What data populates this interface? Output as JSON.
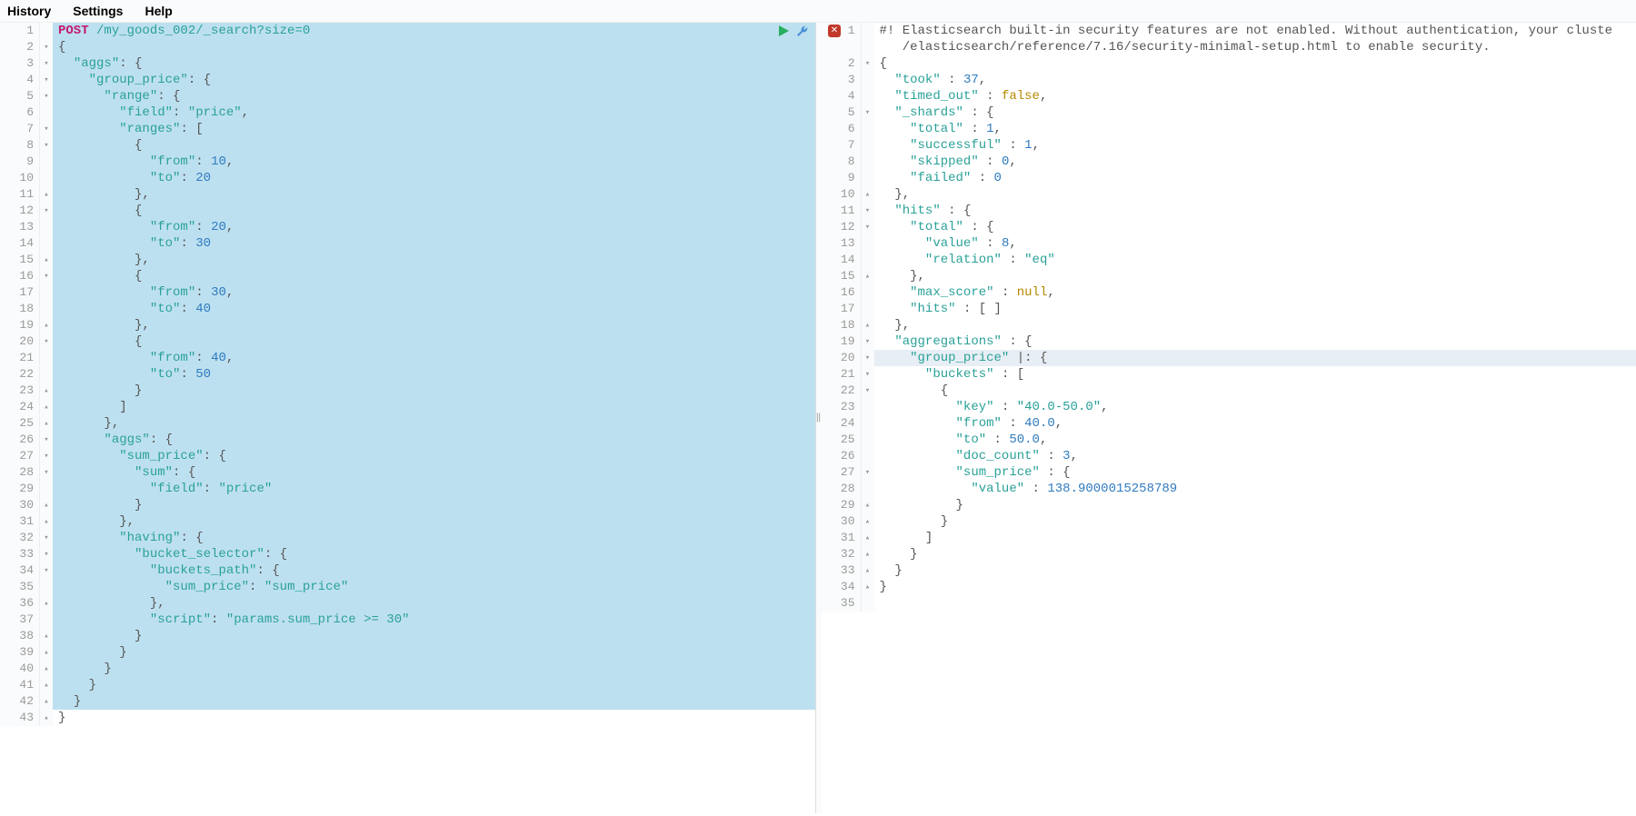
{
  "menu": {
    "history": "History",
    "settings": "Settings",
    "help": "Help"
  },
  "request": {
    "method": "POST",
    "url": "/my_goods_002/_search?size=0",
    "lines": [
      {
        "n": 1,
        "f": "",
        "html": "<span class='method'>POST</span> <span class='url'>/my_goods_002/_search?size=0</span>"
      },
      {
        "n": 2,
        "f": "▾",
        "html": "<span class='pun'>{</span>"
      },
      {
        "n": 3,
        "f": "▾",
        "html": "  <span class='str'>\"aggs\"</span><span class='pun'>: {</span>"
      },
      {
        "n": 4,
        "f": "▾",
        "html": "    <span class='str'>\"group_price\"</span><span class='pun'>: {</span>"
      },
      {
        "n": 5,
        "f": "▾",
        "html": "      <span class='str'>\"range\"</span><span class='pun'>: {</span>"
      },
      {
        "n": 6,
        "f": "",
        "html": "        <span class='str'>\"field\"</span><span class='pun'>: </span><span class='str'>\"price\"</span><span class='pun'>,</span>"
      },
      {
        "n": 7,
        "f": "▾",
        "html": "        <span class='str'>\"ranges\"</span><span class='pun'>: [</span>"
      },
      {
        "n": 8,
        "f": "▾",
        "html": "          <span class='pun'>{</span>"
      },
      {
        "n": 9,
        "f": "",
        "html": "            <span class='str'>\"from\"</span><span class='pun'>: </span><span class='num'>10</span><span class='pun'>,</span>"
      },
      {
        "n": 10,
        "f": "",
        "html": "            <span class='str'>\"to\"</span><span class='pun'>: </span><span class='num'>20</span>"
      },
      {
        "n": 11,
        "f": "▴",
        "html": "          <span class='pun'>},</span>"
      },
      {
        "n": 12,
        "f": "▾",
        "html": "          <span class='pun'>{</span>"
      },
      {
        "n": 13,
        "f": "",
        "html": "            <span class='str'>\"from\"</span><span class='pun'>: </span><span class='num'>20</span><span class='pun'>,</span>"
      },
      {
        "n": 14,
        "f": "",
        "html": "            <span class='str'>\"to\"</span><span class='pun'>: </span><span class='num'>30</span>"
      },
      {
        "n": 15,
        "f": "▴",
        "html": "          <span class='pun'>},</span>"
      },
      {
        "n": 16,
        "f": "▾",
        "html": "          <span class='pun'>{</span>"
      },
      {
        "n": 17,
        "f": "",
        "html": "            <span class='str'>\"from\"</span><span class='pun'>: </span><span class='num'>30</span><span class='pun'>,</span>"
      },
      {
        "n": 18,
        "f": "",
        "html": "            <span class='str'>\"to\"</span><span class='pun'>: </span><span class='num'>40</span>"
      },
      {
        "n": 19,
        "f": "▴",
        "html": "          <span class='pun'>},</span>"
      },
      {
        "n": 20,
        "f": "▾",
        "html": "          <span class='pun'>{</span>"
      },
      {
        "n": 21,
        "f": "",
        "html": "            <span class='str'>\"from\"</span><span class='pun'>: </span><span class='num'>40</span><span class='pun'>,</span>"
      },
      {
        "n": 22,
        "f": "",
        "html": "            <span class='str'>\"to\"</span><span class='pun'>: </span><span class='num'>50</span>"
      },
      {
        "n": 23,
        "f": "▴",
        "html": "          <span class='pun'>}</span>"
      },
      {
        "n": 24,
        "f": "▴",
        "html": "        <span class='pun'>]</span>"
      },
      {
        "n": 25,
        "f": "▴",
        "html": "      <span class='pun'>},</span>"
      },
      {
        "n": 26,
        "f": "▾",
        "html": "      <span class='str'>\"aggs\"</span><span class='pun'>: {</span>"
      },
      {
        "n": 27,
        "f": "▾",
        "html": "        <span class='str'>\"sum_price\"</span><span class='pun'>: {</span>"
      },
      {
        "n": 28,
        "f": "▾",
        "html": "          <span class='str'>\"sum\"</span><span class='pun'>: {</span>"
      },
      {
        "n": 29,
        "f": "",
        "html": "            <span class='str'>\"field\"</span><span class='pun'>: </span><span class='str'>\"price\"</span>"
      },
      {
        "n": 30,
        "f": "▴",
        "html": "          <span class='pun'>}</span>"
      },
      {
        "n": 31,
        "f": "▴",
        "html": "        <span class='pun'>},</span>"
      },
      {
        "n": 32,
        "f": "▾",
        "html": "        <span class='str'>\"having\"</span><span class='pun'>: {</span>"
      },
      {
        "n": 33,
        "f": "▾",
        "html": "          <span class='str'>\"bucket_selector\"</span><span class='pun'>: {</span>"
      },
      {
        "n": 34,
        "f": "▾",
        "html": "            <span class='str'>\"buckets_path\"</span><span class='pun'>: {</span>"
      },
      {
        "n": 35,
        "f": "",
        "html": "              <span class='str'>\"sum_price\"</span><span class='pun'>: </span><span class='str'>\"sum_price\"</span>"
      },
      {
        "n": 36,
        "f": "▴",
        "html": "            <span class='pun'>},</span>"
      },
      {
        "n": 37,
        "f": "",
        "html": "            <span class='str'>\"script\"</span><span class='pun'>: </span><span class='str'>\"params.sum_price &gt;= 30\"</span>"
      },
      {
        "n": 38,
        "f": "▴",
        "html": "          <span class='pun'>}</span>"
      },
      {
        "n": 39,
        "f": "▴",
        "html": "        <span class='pun'>}</span>"
      },
      {
        "n": 40,
        "f": "▴",
        "html": "      <span class='pun'>}</span>"
      },
      {
        "n": 41,
        "f": "▴",
        "html": "    <span class='pun'>}</span>"
      },
      {
        "n": 42,
        "f": "▴",
        "html": "  <span class='pun'>}</span>"
      },
      {
        "n": 43,
        "f": "▴",
        "html": "<span class='pun'>}</span>",
        "noh": true
      }
    ]
  },
  "response": {
    "highlight_line": 20,
    "lines": [
      {
        "n": 1,
        "f": "",
        "err": true,
        "html": "<span class='kw'>#! Elasticsearch built-in security features are not enabled. Without authentication, your cluste</span>"
      },
      {
        "n": "",
        "f": "",
        "html": "   <span class='kw'>/elasticsearch/reference/7.16/security-minimal-setup.html to enable security.</span>"
      },
      {
        "n": 2,
        "f": "▾",
        "html": "<span class='pun'>{</span>"
      },
      {
        "n": 3,
        "f": "",
        "html": "  <span class='str'>\"took\"</span> <span class='pun'>:</span> <span class='num'>37</span><span class='pun'>,</span>"
      },
      {
        "n": 4,
        "f": "",
        "html": "  <span class='str'>\"timed_out\"</span> <span class='pun'>:</span> <span class='bool'>false</span><span class='pun'>,</span>"
      },
      {
        "n": 5,
        "f": "▾",
        "html": "  <span class='str'>\"_shards\"</span> <span class='pun'>: {</span>"
      },
      {
        "n": 6,
        "f": "",
        "html": "    <span class='str'>\"total\"</span> <span class='pun'>:</span> <span class='num'>1</span><span class='pun'>,</span>"
      },
      {
        "n": 7,
        "f": "",
        "html": "    <span class='str'>\"successful\"</span> <span class='pun'>:</span> <span class='num'>1</span><span class='pun'>,</span>"
      },
      {
        "n": 8,
        "f": "",
        "html": "    <span class='str'>\"skipped\"</span> <span class='pun'>:</span> <span class='num'>0</span><span class='pun'>,</span>"
      },
      {
        "n": 9,
        "f": "",
        "html": "    <span class='str'>\"failed\"</span> <span class='pun'>:</span> <span class='num'>0</span>"
      },
      {
        "n": 10,
        "f": "▴",
        "html": "  <span class='pun'>},</span>"
      },
      {
        "n": 11,
        "f": "▾",
        "html": "  <span class='str'>\"hits\"</span> <span class='pun'>: {</span>"
      },
      {
        "n": 12,
        "f": "▾",
        "html": "    <span class='str'>\"total\"</span> <span class='pun'>: {</span>"
      },
      {
        "n": 13,
        "f": "",
        "html": "      <span class='str'>\"value\"</span> <span class='pun'>:</span> <span class='num'>8</span><span class='pun'>,</span>"
      },
      {
        "n": 14,
        "f": "",
        "html": "      <span class='str'>\"relation\"</span> <span class='pun'>:</span> <span class='str'>\"eq\"</span>"
      },
      {
        "n": 15,
        "f": "▴",
        "html": "    <span class='pun'>},</span>"
      },
      {
        "n": 16,
        "f": "",
        "html": "    <span class='str'>\"max_score\"</span> <span class='pun'>:</span> <span class='null'>null</span><span class='pun'>,</span>"
      },
      {
        "n": 17,
        "f": "",
        "html": "    <span class='str'>\"hits\"</span> <span class='pun'>:</span> <span class='pun'>[ ]</span>"
      },
      {
        "n": 18,
        "f": "▴",
        "html": "  <span class='pun'>},</span>"
      },
      {
        "n": 19,
        "f": "▾",
        "html": "  <span class='str'>\"aggregations\"</span> <span class='pun'>: {</span>"
      },
      {
        "n": 20,
        "f": "▾",
        "html": "    <span class='str'>\"group_price\"</span> <span class='pun'>|: {</span>"
      },
      {
        "n": 21,
        "f": "▾",
        "html": "      <span class='str'>\"buckets\"</span> <span class='pun'>: [</span>"
      },
      {
        "n": 22,
        "f": "▾",
        "html": "        <span class='pun'>{</span>"
      },
      {
        "n": 23,
        "f": "",
        "html": "          <span class='str'>\"key\"</span> <span class='pun'>:</span> <span class='str'>\"40.0-50.0\"</span><span class='pun'>,</span>"
      },
      {
        "n": 24,
        "f": "",
        "html": "          <span class='str'>\"from\"</span> <span class='pun'>:</span> <span class='num'>40.0</span><span class='pun'>,</span>"
      },
      {
        "n": 25,
        "f": "",
        "html": "          <span class='str'>\"to\"</span> <span class='pun'>:</span> <span class='num'>50.0</span><span class='pun'>,</span>"
      },
      {
        "n": 26,
        "f": "",
        "html": "          <span class='str'>\"doc_count\"</span> <span class='pun'>:</span> <span class='num'>3</span><span class='pun'>,</span>"
      },
      {
        "n": 27,
        "f": "▾",
        "html": "          <span class='str'>\"sum_price\"</span> <span class='pun'>: {</span>"
      },
      {
        "n": 28,
        "f": "",
        "html": "            <span class='str'>\"value\"</span> <span class='pun'>:</span> <span class='num'>138.9000015258789</span>"
      },
      {
        "n": 29,
        "f": "▴",
        "html": "          <span class='pun'>}</span>"
      },
      {
        "n": 30,
        "f": "▴",
        "html": "        <span class='pun'>}</span>"
      },
      {
        "n": 31,
        "f": "▴",
        "html": "      <span class='pun'>]</span>"
      },
      {
        "n": 32,
        "f": "▴",
        "html": "    <span class='pun'>}</span>"
      },
      {
        "n": 33,
        "f": "▴",
        "html": "  <span class='pun'>}</span>"
      },
      {
        "n": 34,
        "f": "▴",
        "html": "<span class='pun'>}</span>"
      },
      {
        "n": 35,
        "f": "",
        "html": ""
      }
    ]
  }
}
